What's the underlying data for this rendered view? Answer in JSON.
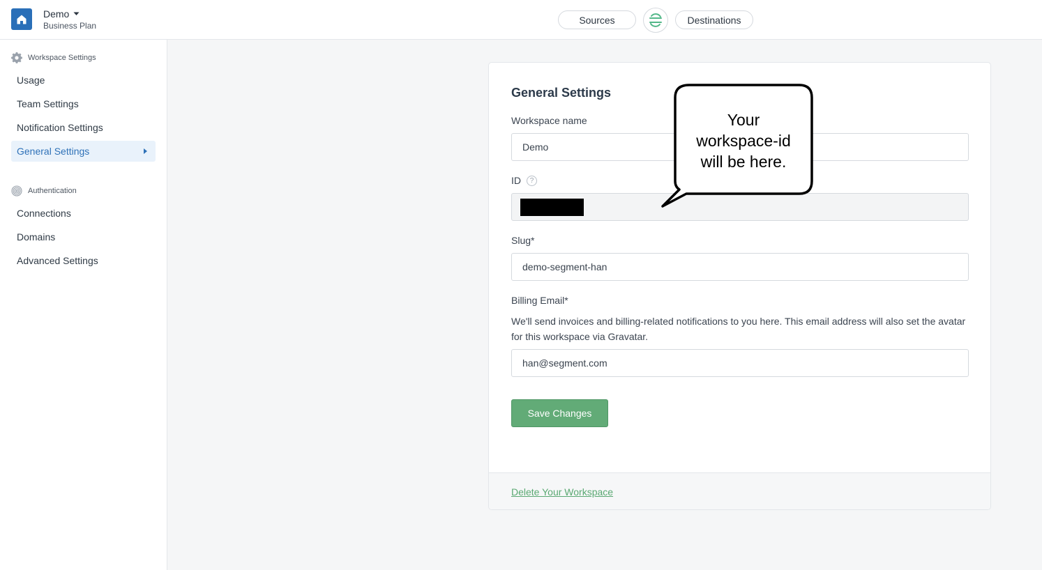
{
  "header": {
    "workspace_name": "Demo",
    "plan": "Business Plan",
    "sources_label": "Sources",
    "destinations_label": "Destinations"
  },
  "sidebar": {
    "workspace_section": "Workspace Settings",
    "workspace_items": [
      {
        "label": "Usage"
      },
      {
        "label": "Team Settings"
      },
      {
        "label": "Notification Settings"
      },
      {
        "label": "General Settings"
      }
    ],
    "auth_section": "Authentication",
    "auth_items": [
      {
        "label": "Connections"
      },
      {
        "label": "Domains"
      },
      {
        "label": "Advanced Settings"
      }
    ]
  },
  "card": {
    "title": "General Settings",
    "workspace_name_label": "Workspace name",
    "workspace_name_value": "Demo",
    "id_label": "ID",
    "help_glyph": "?",
    "slug_label": "Slug*",
    "slug_value": "demo-segment-han",
    "billing_label": "Billing Email*",
    "billing_desc": "We'll send invoices and billing-related notifications to you here. This email address will also set the avatar for this workspace via Gravatar.",
    "billing_value": "han@segment.com",
    "save_label": "Save Changes",
    "delete_label": "Delete Your Workspace"
  },
  "callout": {
    "line1": "Your",
    "line2": "workspace-id",
    "line3": "will be here."
  },
  "colors": {
    "brand_blue": "#2a6fb8",
    "save_green": "#62ab77",
    "active_nav_bg": "#e9f2fb"
  },
  "icons": [
    "home-icon",
    "chevron-down-icon",
    "segment-logo-icon",
    "gear-icon",
    "fingerprint-icon",
    "caret-right-icon",
    "help-icon"
  ]
}
